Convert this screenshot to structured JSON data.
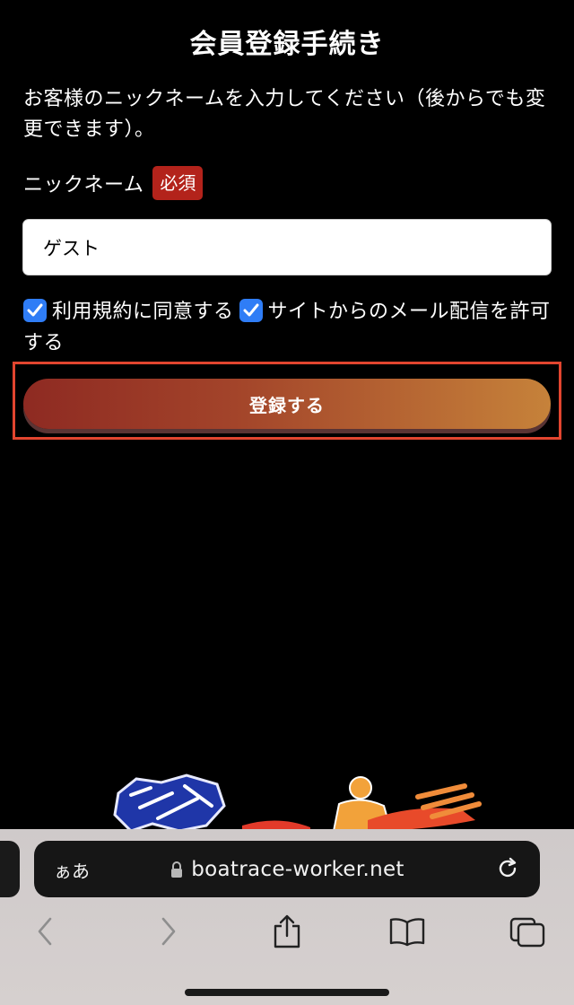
{
  "header": {
    "title": "会員登録手続き"
  },
  "form": {
    "intro": "お客様のニックネームを入力してください（後からでも変更できます）。",
    "nickname_label": "ニックネーム",
    "required_badge": "必須",
    "nickname_value": "ゲスト",
    "terms_label": "利用規約に同意する",
    "mail_label": "サイトからのメール配信を許可する",
    "terms_checked": true,
    "mail_checked": true,
    "register_label": "登録する"
  },
  "browser": {
    "text_size_label": "ぁあ",
    "url": "boatrace-worker.net",
    "icons": [
      "lock-icon",
      "reload-icon",
      "back-icon",
      "forward-icon",
      "share-icon",
      "bookmarks-icon",
      "tabs-icon"
    ]
  },
  "colors": {
    "badge": "#b3231b",
    "checkbox": "#2f7df6",
    "button_start": "#8e2a22",
    "button_end": "#c6823a",
    "highlight": "#e2452f"
  }
}
